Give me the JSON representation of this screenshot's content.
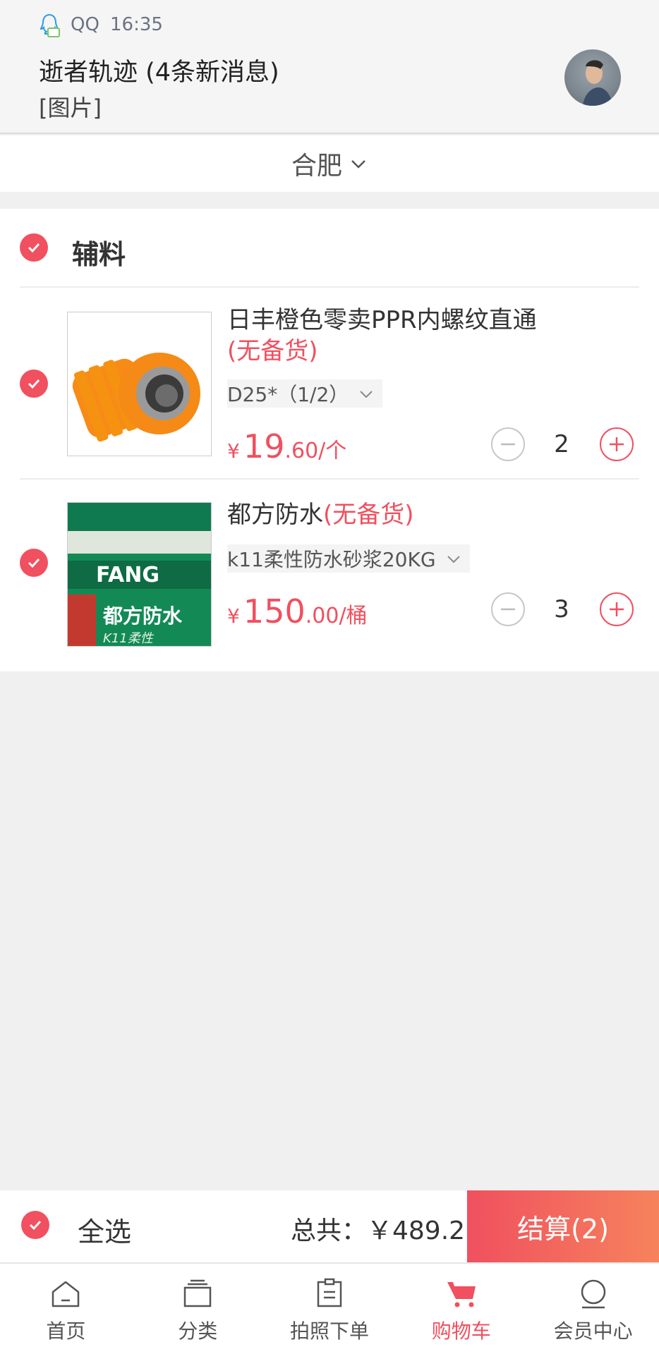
{
  "notification": {
    "app": "QQ",
    "time": "16:35",
    "title": "逝者轨迹 (4条新消息)",
    "text": "[图片]"
  },
  "city": {
    "name": "合肥"
  },
  "cart": {
    "group_title": "辅料",
    "items": [
      {
        "name": "日丰橙色零卖PPR内螺纹直通",
        "stock_status": "(无备货)",
        "spec": "D25*（1/2）",
        "currency": "¥",
        "price_int": "19",
        "price_dec": ".60/个",
        "quantity": "2"
      },
      {
        "name": "都方防水",
        "stock_status": "(无备货)",
        "spec": "k11柔性防水砂浆20KG",
        "currency": "¥",
        "price_int": "150",
        "price_dec": ".00/桶",
        "quantity": "3"
      }
    ]
  },
  "checkout": {
    "select_all_label": "全选",
    "total_label": "总共：￥489.2",
    "settle_label": "结算(2)"
  },
  "tabs": [
    {
      "label": "首页",
      "icon": "home-icon"
    },
    {
      "label": "分类",
      "icon": "category-icon"
    },
    {
      "label": "拍照下单",
      "icon": "clipboard-icon"
    },
    {
      "label": "购物车",
      "icon": "cart-icon",
      "active": true
    },
    {
      "label": "会员中心",
      "icon": "user-icon"
    }
  ],
  "colors": {
    "accent": "#f0505f",
    "accent_end": "#f6835c"
  }
}
